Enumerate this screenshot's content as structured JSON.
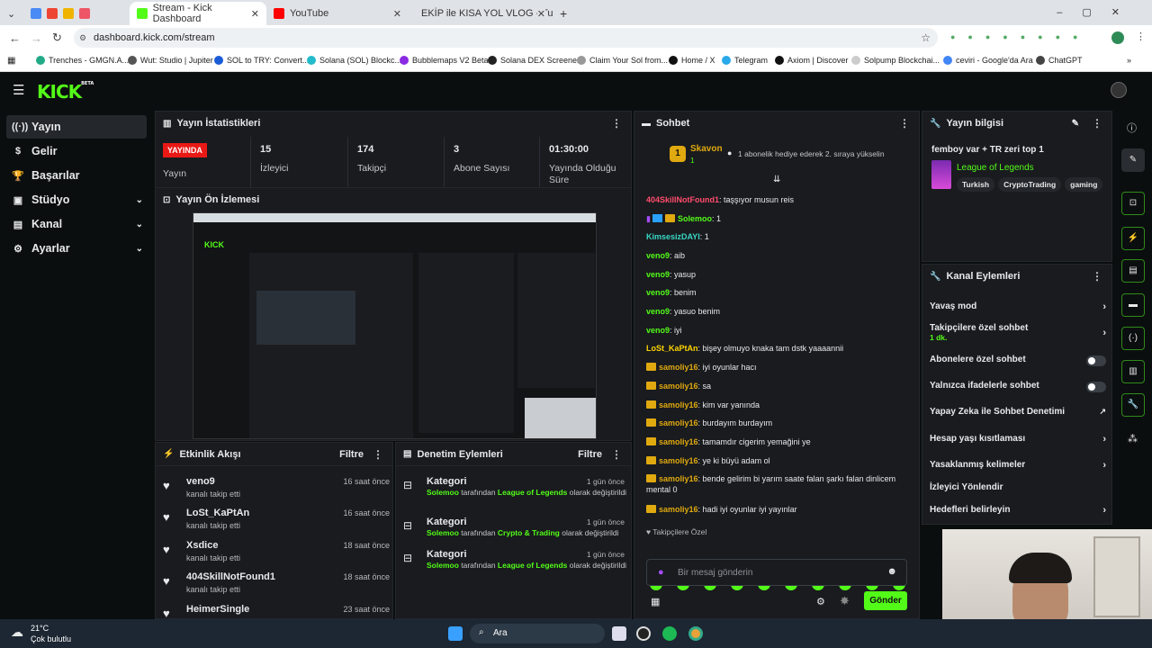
{
  "browser": {
    "tabs": [
      {
        "label": "Stream - Kick Dashboard",
        "color": "#53fc18"
      },
      {
        "label": "YouTube",
        "color": "#ff0000"
      },
      {
        "label": "EKİP ile KISA YOL VLOG - Tutuk",
        "color": "#e91916"
      }
    ],
    "url": "dashboard.kick.com/stream",
    "bookmarks": [
      "Trenches - GMGN.A...",
      "Wut: Studio | Jupiter",
      "SOL to TRY: Convert...",
      "Solana (SOL) Blockc...",
      "Bubblemaps V2 Beta",
      "Solana DEX Screener",
      "Claim Your Sol from...",
      "Home / X",
      "Telegram",
      "Axiom | Discover",
      "Solpump Blockchai...",
      "ceviri - Google'da Ara",
      "ChatGPT"
    ]
  },
  "app": {
    "logo": "KICK",
    "logo_sup": "BETA"
  },
  "sidebar": {
    "items": [
      {
        "label": "Yayın",
        "icon": "broadcast-icon"
      },
      {
        "label": "Gelir",
        "icon": "dollar-icon"
      },
      {
        "label": "Başarılar",
        "icon": "trophy-icon"
      },
      {
        "label": "Stüdyo",
        "icon": "studio-icon"
      },
      {
        "label": "Kanal",
        "icon": "channel-icon"
      },
      {
        "label": "Ayarlar",
        "icon": "gear-icon"
      }
    ]
  },
  "stats": {
    "title": "Yayın İstatistikleri",
    "live_badge": "YAYINDA",
    "live_label": "Yayın",
    "viewers": "15",
    "viewers_label": "İzleyici",
    "followers": "174",
    "followers_label": "Takipçi",
    "subs": "3",
    "subs_label": "Abone Sayısı",
    "duration": "01:30:00",
    "duration_label": "Yayında Olduğu Süre"
  },
  "preview": {
    "title": "Yayın Ön İzlemesi"
  },
  "events": {
    "title": "Etkinlik Akışı",
    "filter": "Filtre",
    "items": [
      {
        "name": "veno9",
        "sub": "kanalı takip etti",
        "time": "16 saat önce"
      },
      {
        "name": "LoSt_KaPtAn",
        "sub": "kanalı takip etti",
        "time": "16 saat önce"
      },
      {
        "name": "Xsdice",
        "sub": "kanalı takip etti",
        "time": "18 saat önce"
      },
      {
        "name": "404SkillNotFound1",
        "sub": "kanalı takip etti",
        "time": "18 saat önce"
      },
      {
        "name": "HeimerSingle",
        "sub": "",
        "time": "23 saat önce"
      }
    ]
  },
  "moderation": {
    "title": "Denetim Eylemleri",
    "filter": "Filtre",
    "items": [
      {
        "title": "Kategori",
        "user": "Solemoo",
        "mid": " tarafından ",
        "cat": "League of Legends",
        "end": " olarak değiştirildi",
        "time": "1 gün önce"
      },
      {
        "title": "Kategori",
        "user": "Solemoo",
        "mid": " tarafından ",
        "cat": "Crypto & Trading",
        "end": " olarak değiştirildi",
        "time": "1 gün önce"
      },
      {
        "title": "Kategori",
        "user": "Solemoo",
        "mid": " tarafından ",
        "cat": "League of Legends",
        "end": " olarak değiştirildi",
        "time": "1 gün önce"
      }
    ]
  },
  "chat": {
    "title": "Sohbet",
    "pinned_user": "Skavon",
    "pinned_rank": "1",
    "pinned_count": "1",
    "pinned_msg": "1 abonelik hediye ederek 2. sıraya yükselin",
    "messages": [
      {
        "user": "404SkillNotFound1",
        "color": "#ff4d6d",
        "text": ": taşşıyor musun reis",
        "badges": 0
      },
      {
        "user": "Solemoo",
        "color": "#53fc18",
        "text": ": 1",
        "badges": 3
      },
      {
        "user": "KimsesizDAYI",
        "color": "#3ad7c4",
        "text": ": 1",
        "badges": 0
      },
      {
        "user": "veno9",
        "color": "#53fc18",
        "text": ": aib",
        "badges": 0
      },
      {
        "user": "veno9",
        "color": "#53fc18",
        "text": ": yasup",
        "badges": 0
      },
      {
        "user": "veno9",
        "color": "#53fc18",
        "text": ": benim",
        "badges": 0
      },
      {
        "user": "veno9",
        "color": "#53fc18",
        "text": ": yasuo benim",
        "badges": 0
      },
      {
        "user": "veno9",
        "color": "#53fc18",
        "text": ": iyi",
        "badges": 0
      },
      {
        "user": "LoSt_KaPtAn",
        "color": "#ffd400",
        "text": ": bişey olmuyo knaka tam dstk yaaaannii",
        "badges": 0
      },
      {
        "user": "samoliy16",
        "color": "#e0a90f",
        "text": ": iyi oyunlar hacı",
        "badges": 1
      },
      {
        "user": "samoliy16",
        "color": "#e0a90f",
        "text": ": sa",
        "badges": 1
      },
      {
        "user": "samoliy16",
        "color": "#e0a90f",
        "text": ": kim var yanında",
        "badges": 1
      },
      {
        "user": "samoliy16",
        "color": "#e0a90f",
        "text": ": burdayım burdayım",
        "badges": 1
      },
      {
        "user": "samoliy16",
        "color": "#e0a90f",
        "text": ": tamamdır cigerim yemağini ye",
        "badges": 1
      },
      {
        "user": "samoliy16",
        "color": "#e0a90f",
        "text": ": ye ki büyü adam ol",
        "badges": 1
      },
      {
        "user": "samoliy16",
        "color": "#e0a90f",
        "text": ": bende gelirim bi yarım saate falan şarkı falan dinlicem mental 0",
        "badges": 1
      },
      {
        "user": "samoliy16",
        "color": "#e0a90f",
        "text": ": hadi iyi oyunlar iyi yayınlar",
        "badges": 1
      }
    ],
    "followers_only": "Takipçilere Özel",
    "placeholder": "Bir mesaj gönderin",
    "send": "Gönder"
  },
  "info": {
    "title": "Yayın bilgisi",
    "stream_title": "femboy var + TR zeri top 1",
    "category": "League of Legends",
    "tags": [
      "Turkish",
      "CryptoTrading",
      "gaming"
    ]
  },
  "channel_actions": {
    "title": "Kanal Eylemleri",
    "items": [
      {
        "label": "Yavaş mod",
        "control": "chevron"
      },
      {
        "label": "Takipçilere özel sohbet",
        "sub": "1 dk.",
        "control": "chevron"
      },
      {
        "label": "Abonelere özel sohbet",
        "control": "toggle"
      },
      {
        "label": "Yalnızca ifadelerle sohbet",
        "control": "toggle"
      },
      {
        "label": "Yapay Zeka ile Sohbet Denetimi",
        "control": "external"
      },
      {
        "label": "Hesap yaşı kısıtlaması",
        "control": "chevron"
      },
      {
        "label": "Yasaklanmış kelimeler",
        "control": "chevron"
      },
      {
        "label": "İzleyici Yönlendir",
        "control": "none"
      },
      {
        "label": "Hedefleri belirleyin",
        "control": "chevron"
      }
    ]
  },
  "taskbar": {
    "temp": "21°C",
    "weather": "Çok bulutlu",
    "search": "Ara"
  },
  "colors": {
    "accent": "#53fc18",
    "bg": "#0b0e0f",
    "panel": "#191b1f",
    "live": "#e91916"
  }
}
